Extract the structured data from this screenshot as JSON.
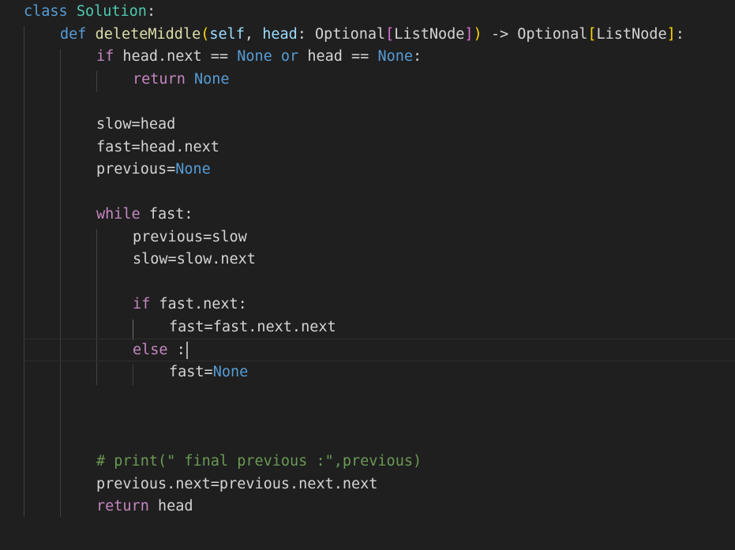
{
  "editor": {
    "language": "python",
    "theme_colors": {
      "background": "#1f1f1f",
      "keyword_blue": "#569cd6",
      "keyword_purple": "#c586c0",
      "class_name": "#4ec9b0",
      "function_name": "#dcdcaa",
      "parameter": "#9cdcfe",
      "comment": "#6a9955"
    },
    "cursor_line": 16,
    "lines": [
      [
        {
          "t": "class",
          "c": "kw-blue"
        },
        {
          "t": " ",
          "c": "plain"
        },
        {
          "t": "Solution",
          "c": "cls"
        },
        {
          "t": ":",
          "c": "plain"
        }
      ],
      [
        {
          "t": "def",
          "c": "kw-blue"
        },
        {
          "t": " ",
          "c": "plain"
        },
        {
          "t": "deleteMiddle",
          "c": "fn"
        },
        {
          "t": "(",
          "c": "brk-yellow"
        },
        {
          "t": "self",
          "c": "param"
        },
        {
          "t": ", ",
          "c": "plain"
        },
        {
          "t": "head",
          "c": "param"
        },
        {
          "t": ": Optional",
          "c": "plain"
        },
        {
          "t": "[",
          "c": "brk-pink"
        },
        {
          "t": "ListNode",
          "c": "plain"
        },
        {
          "t": "]",
          "c": "brk-pink"
        },
        {
          "t": ")",
          "c": "brk-yellow"
        },
        {
          "t": " -> Optional",
          "c": "plain"
        },
        {
          "t": "[",
          "c": "brk-yellow"
        },
        {
          "t": "ListNode",
          "c": "plain"
        },
        {
          "t": "]",
          "c": "brk-yellow"
        },
        {
          "t": ":",
          "c": "plain"
        }
      ],
      [
        {
          "t": "if",
          "c": "kw-purple"
        },
        {
          "t": " head.next == ",
          "c": "plain"
        },
        {
          "t": "None",
          "c": "kw-blue"
        },
        {
          "t": " ",
          "c": "plain"
        },
        {
          "t": "or",
          "c": "kw-blue"
        },
        {
          "t": " head == ",
          "c": "plain"
        },
        {
          "t": "None",
          "c": "kw-blue"
        },
        {
          "t": ":",
          "c": "plain"
        }
      ],
      [
        {
          "t": "return",
          "c": "kw-purple"
        },
        {
          "t": " ",
          "c": "plain"
        },
        {
          "t": "None",
          "c": "kw-blue"
        }
      ],
      [],
      [
        {
          "t": "slow=head",
          "c": "plain"
        }
      ],
      [
        {
          "t": "fast=head.next",
          "c": "plain"
        }
      ],
      [
        {
          "t": "previous=",
          "c": "plain"
        },
        {
          "t": "None",
          "c": "kw-blue"
        }
      ],
      [],
      [
        {
          "t": "while",
          "c": "kw-purple"
        },
        {
          "t": " fast:",
          "c": "plain"
        }
      ],
      [
        {
          "t": "previous=slow",
          "c": "plain"
        }
      ],
      [
        {
          "t": "slow=slow.next",
          "c": "plain"
        }
      ],
      [],
      [
        {
          "t": "if",
          "c": "kw-purple"
        },
        {
          "t": " fast.next:",
          "c": "plain"
        }
      ],
      [
        {
          "t": "fast=fast.next.next",
          "c": "plain"
        }
      ],
      [
        {
          "t": "else",
          "c": "kw-purple"
        },
        {
          "t": " :",
          "c": "plain"
        }
      ],
      [
        {
          "t": "fast=",
          "c": "plain"
        },
        {
          "t": "None",
          "c": "kw-blue"
        }
      ],
      [],
      [],
      [],
      [
        {
          "t": "# print(\" final previous :\",previous)",
          "c": "comment"
        }
      ],
      [
        {
          "t": "previous.next=previous.next.next",
          "c": "plain"
        }
      ],
      [
        {
          "t": "return",
          "c": "kw-purple"
        },
        {
          "t": " head",
          "c": "plain"
        }
      ]
    ]
  }
}
